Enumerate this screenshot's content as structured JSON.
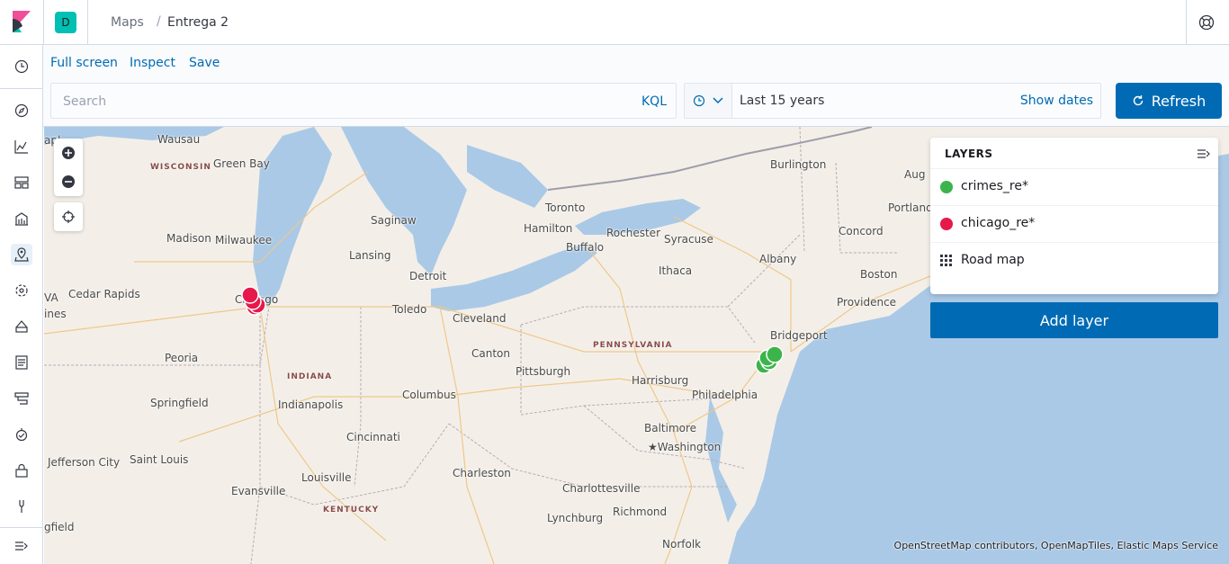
{
  "header": {
    "space_initial": "D",
    "breadcrumbs": [
      "Maps",
      "Entrega 2"
    ],
    "breadcrumb_separator": "/"
  },
  "nav": {
    "items": [
      "clock-icon",
      "compass-icon",
      "visualize-icon",
      "dashboard-icon",
      "canvas-icon",
      "maps-icon",
      "ml-icon",
      "infrastructure-icon",
      "logs-icon",
      "apm-icon",
      "uptime-icon",
      "security-icon",
      "devtools-icon"
    ],
    "collapse": "collapse-nav-icon"
  },
  "menu": {
    "full_screen": "Full screen",
    "inspect": "Inspect",
    "save": "Save"
  },
  "query": {
    "placeholder": "Search",
    "language": "KQL"
  },
  "time": {
    "range": "Last 15 years",
    "show_dates": "Show dates",
    "refresh": "Refresh"
  },
  "map": {
    "places": {
      "wausau": "Wausau",
      "green_bay": "Green Bay",
      "madison": "Madison",
      "milwaukee": "Milwaukee",
      "cedar_rapids": "Cedar Rapids",
      "chicago": "Chicago",
      "peoria": "Peoria",
      "springfield": "Springfield",
      "jefferson_city": "Jefferson City",
      "saint_louis": "Saint Louis",
      "indianapolis": "Indianapolis",
      "evansville": "Evansville",
      "louisville": "Louisville",
      "cincinnati": "Cincinnati",
      "columbus": "Columbus",
      "lansing": "Lansing",
      "saginaw": "Saginaw",
      "detroit": "Detroit",
      "toledo": "Toledo",
      "cleveland": "Cleveland",
      "canton": "Canton",
      "pittsburgh": "Pittsburgh",
      "charleston": "Charleston",
      "toronto": "Toronto",
      "hamilton": "Hamilton",
      "buffalo": "Buffalo",
      "rochester": "Rochester",
      "syracuse": "Syracuse",
      "ithaca": "Ithaca",
      "albany": "Albany",
      "burlington": "Burlington",
      "concord": "Concord",
      "portland": "Portland",
      "boston": "Boston",
      "providence": "Providence",
      "bridgeport": "Bridgeport",
      "harrisburg": "Harrisburg",
      "philadelphia": "Philadelphia",
      "baltimore": "Baltimore",
      "washington": "★Washington",
      "charlottesville": "Charlottesville",
      "richmond": "Richmond",
      "lynchburg": "Lynchburg",
      "norfolk": "Norfolk",
      "aug": "Aug",
      "apl": "apl",
      "ines": "ines",
      "gfield": "gfield",
      "ava": "VA"
    },
    "states": {
      "wisconsin": "WISCONSIN",
      "indiana": "INDIANA",
      "pennsylvania": "PENNSYLVANIA",
      "kentucky": "KENTUCKY"
    },
    "attribution": "OpenStreetMap contributors, OpenMapTiles, Elastic Maps Service"
  },
  "layers": {
    "title": "LAYERS",
    "items": [
      {
        "name": "crimes_re*",
        "color": "#3cb44b"
      },
      {
        "name": "chicago_re*",
        "color": "#e6194b"
      },
      {
        "name": "Road map",
        "icon": "grid-icon"
      }
    ],
    "add_layer": "Add layer"
  },
  "colors": {
    "accent": "#006bb4",
    "water": "#aac9e6",
    "land": "#f3efe8"
  }
}
